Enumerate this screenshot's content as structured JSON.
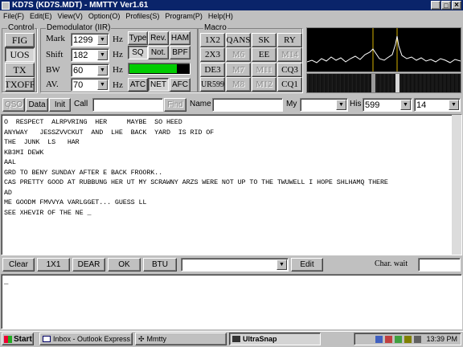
{
  "window": {
    "title": "KD7S (KD7S.MDT) - MMTTY Ver1.61",
    "controls": [
      "_",
      "□",
      "×"
    ]
  },
  "menu": [
    "File(F)",
    "Edit(E)",
    "View(V)",
    "Option(O)",
    "Profiles(S)",
    "Program(P)",
    "Help(H)"
  ],
  "control": {
    "title": "Control",
    "buttons": [
      "FIG",
      "UOS",
      "TX",
      "TXOFF"
    ]
  },
  "demod": {
    "title": "Demodulator (IIR)",
    "mark": {
      "label": "Mark",
      "value": "1299",
      "unit": "Hz"
    },
    "shift": {
      "label": "Shift",
      "value": "182",
      "unit": "Hz"
    },
    "bw": {
      "label": "BW",
      "value": "60",
      "unit": "Hz"
    },
    "av": {
      "label": "AV.",
      "value": "70",
      "unit": "Hz"
    },
    "buttons": [
      "Type",
      "Rev.",
      "HAM",
      "SQ",
      "Not.",
      "BPF",
      "ATC",
      "NET",
      "AFC"
    ],
    "level_fraction": 0.78
  },
  "macro": {
    "title": "Macro",
    "buttons": [
      "1X2",
      "QANS",
      "SK",
      "RY",
      "2X3",
      "M6",
      "EE",
      "M14",
      "DE3",
      "M7",
      "M11",
      "CQ3",
      "UR599",
      "M8",
      "M12",
      "CQ1"
    ]
  },
  "qso": {
    "qso": "QSO",
    "data": "Data",
    "init": "Init",
    "call": "Call",
    "find": "Find",
    "name": "Name",
    "my": "My",
    "his": "His",
    "his_value": "599",
    "my_value": "14"
  },
  "rx_lines": [
    "O  RESPECT  ALRPVRING  HER     MAYBE  SO HEED",
    "ANYWAY   JESSZVVCKUT  AND  LHE  BACK  YARD  IS RID OF",
    "THE  JUNK  LS   HAR",
    "KB3MI DEWK",
    "AAL",
    "GRD TO BENY SUNDAY AFTER E BACK FROORK..",
    "CAS PRETTY GOOD AT RUBBUNG HER UT MY SCRAWNY ARZS WERE NOT UP TO THE TWUWELL I HOPE SHLHAMQ THERE",
    "AD",
    "ME GOODM FMVVYA VARLGGET... GUESS LL",
    "SEE XHEVIR OF THE NE _"
  ],
  "bottom_bar": {
    "buttons": [
      "Clear",
      "1X1",
      "DEAR",
      "OK",
      "BTU"
    ],
    "edit": "Edit",
    "charwait": "Char. wait"
  },
  "tx_text": "_",
  "taskbar": {
    "start": "Start",
    "items": [
      "Inbox - Outlook Express",
      "Mmtty",
      "UltraSnap"
    ],
    "clock": "13:39 PM"
  },
  "colors": {
    "title_bar": "#0a246a",
    "rx_bg": "#ffffff",
    "level": "#00cc00",
    "scope_bg": "#000000",
    "marker": "#d4b000"
  }
}
